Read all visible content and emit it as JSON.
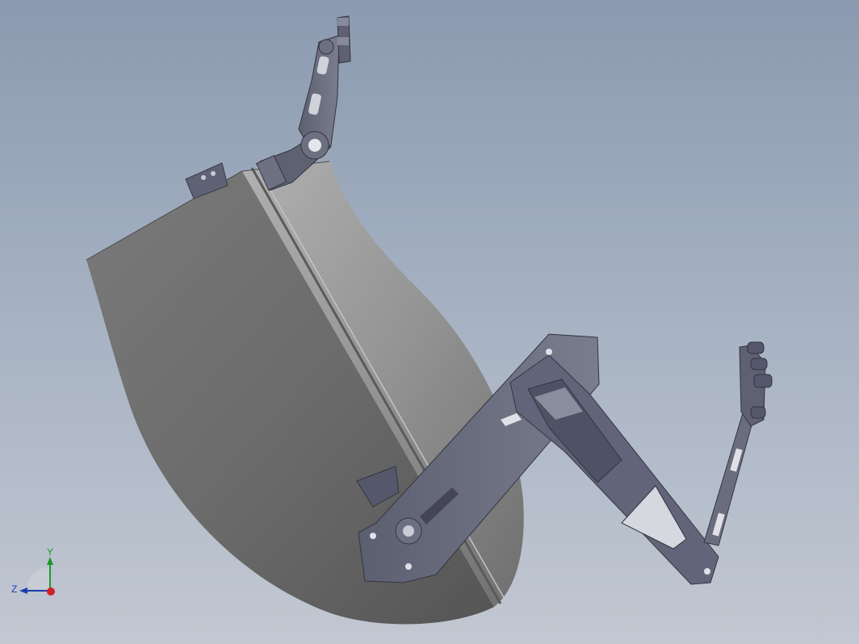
{
  "view": {
    "background_top": "#8b9ab0",
    "background_bottom": "#c2c8d2",
    "model_color": "#6e7182",
    "shell_color": "#8f9090"
  },
  "triad": {
    "y_label": "Y",
    "z_label": "Z",
    "y_color": "#1a9a2a",
    "z_color": "#1f3bb0",
    "x_color": "#d0202a",
    "x_icon": "x-axis-dot-icon"
  }
}
